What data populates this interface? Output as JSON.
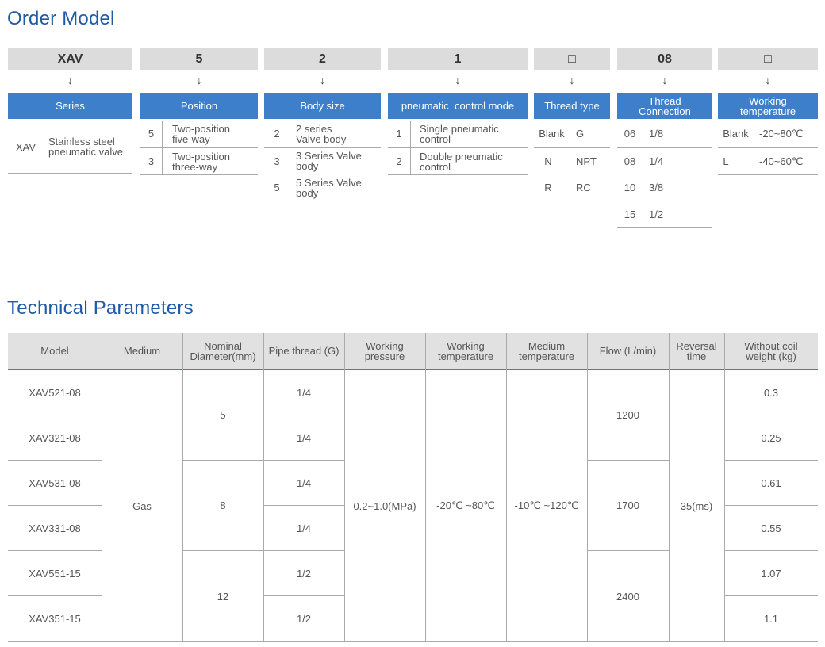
{
  "order_model": {
    "title": "Order Model",
    "codes": [
      "XAV",
      "5",
      "2",
      "1",
      "□",
      "08",
      "□"
    ],
    "arrow": "↓",
    "headers": [
      "Series",
      "Position",
      "Body size",
      "pneumatic  control mode",
      "Thread type",
      "Thread\nConnection",
      "Working\ntemperature"
    ],
    "series": {
      "code": "XAV",
      "desc": "Stainless steel\npneumatic valve"
    },
    "position": [
      {
        "code": "5",
        "desc": "Two-position\nfive-way"
      },
      {
        "code": "3",
        "desc": "Two-position\nthree-way"
      }
    ],
    "body_size": [
      {
        "code": "2",
        "desc": "2 series\nValve body"
      },
      {
        "code": "3",
        "desc": "3 Series Valve\nbody"
      },
      {
        "code": "5",
        "desc": "5 Series Valve\nbody"
      }
    ],
    "control_mode": [
      {
        "code": "1",
        "desc": "Single pneumatic\ncontrol"
      },
      {
        "code": "2",
        "desc": "Double pneumatic\ncontrol"
      }
    ],
    "thread_type": [
      {
        "code": "Blank",
        "desc": "G"
      },
      {
        "code": "N",
        "desc": "NPT"
      },
      {
        "code": "R",
        "desc": "RC"
      }
    ],
    "thread_connection": [
      {
        "code": "06",
        "desc": "1/8"
      },
      {
        "code": "08",
        "desc": "1/4"
      },
      {
        "code": "10",
        "desc": "3/8"
      },
      {
        "code": "15",
        "desc": "1/2"
      }
    ],
    "working_temperature": [
      {
        "code": "Blank",
        "desc": "-20~80℃"
      },
      {
        "code": "L",
        "desc": "-40~60℃"
      }
    ]
  },
  "technical_parameters": {
    "title": "Technical Parameters",
    "headers": [
      "Model",
      "Medium",
      "Nominal\nDiameter(mm)",
      "Pipe thread (G)",
      "Working\npressure",
      "Working\ntemperature",
      "Medium\ntemperature",
      "Flow (L/min)",
      "Reversal\ntime",
      "Without coil\nweight (kg)"
    ],
    "models": [
      "XAV521-08",
      "XAV321-08",
      "XAV531-08",
      "XAV331-08",
      "XAV551-15",
      "XAV351-15"
    ],
    "medium": "Gas",
    "nominal_diameter": [
      "5",
      "8",
      "12"
    ],
    "pipe_thread": [
      "1/4",
      "1/4",
      "1/4",
      "1/4",
      "1/2",
      "1/2"
    ],
    "working_pressure": "0.2~1.0(MPa)",
    "working_temperature": "-20℃ ~80℃",
    "medium_temperature": "-10℃ ~120℃",
    "flow": [
      "1200",
      "1700",
      "2400"
    ],
    "reversal_time": "35(ms)",
    "weight": [
      "0.3",
      "0.25",
      "0.61",
      "0.55",
      "1.07",
      "1.1"
    ]
  },
  "colors": {
    "title_blue": "#1f5aa6",
    "header_blue": "#3d7fcb",
    "code_gray": "#dcdcdc",
    "table_head_gray": "#e1e1e1",
    "accent_line": "#3d7fcb"
  }
}
